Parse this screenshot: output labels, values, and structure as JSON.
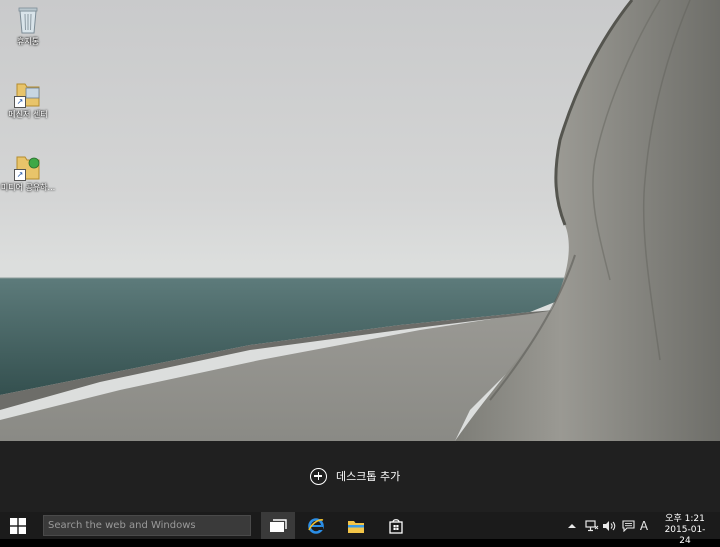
{
  "desktop": {
    "icons": [
      {
        "label": "휴지통",
        "icon": "recycle-bin-icon"
      },
      {
        "label": "메신저 센터",
        "icon": "folder-shortcut-icon"
      },
      {
        "label": "미디어 공유하...",
        "icon": "folder-shortcut-icon"
      }
    ]
  },
  "task_view": {
    "add_desktop_label": "데스크톱 추가"
  },
  "taskbar": {
    "search_placeholder": "Search the web and Windows",
    "apps": [
      {
        "name": "Task View",
        "icon": "task-view-icon"
      },
      {
        "name": "Internet Explorer",
        "icon": "internet-explorer-icon"
      },
      {
        "name": "File Explorer",
        "icon": "file-explorer-icon"
      },
      {
        "name": "Store",
        "icon": "store-icon"
      }
    ],
    "tray": {
      "ime_label": "A",
      "time": "오후 1:21",
      "date": "2015-01-24"
    }
  },
  "colors": {
    "taskbar": "#1b1b1b",
    "task_view_band": "#202020",
    "accent": "#1e90ff"
  }
}
